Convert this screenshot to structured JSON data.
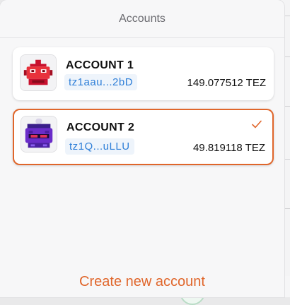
{
  "sheet": {
    "title": "Accounts"
  },
  "accounts": [
    {
      "name": "ACCOUNT 1",
      "address": "tz1aau...2bD",
      "balance": "149.077512 TEZ",
      "selected": false,
      "avatar_icon": "red-robot-avatar-icon"
    },
    {
      "name": "ACCOUNT 2",
      "address": "tz1Q...uLLU",
      "balance": "49.819118 TEZ",
      "selected": true,
      "avatar_icon": "purple-robot-avatar-icon"
    }
  ],
  "actions": {
    "create_label": "Create new account"
  },
  "colors": {
    "accent": "#e0662b",
    "address_text": "#2f7fd8",
    "address_bg": "#eef4fb"
  }
}
